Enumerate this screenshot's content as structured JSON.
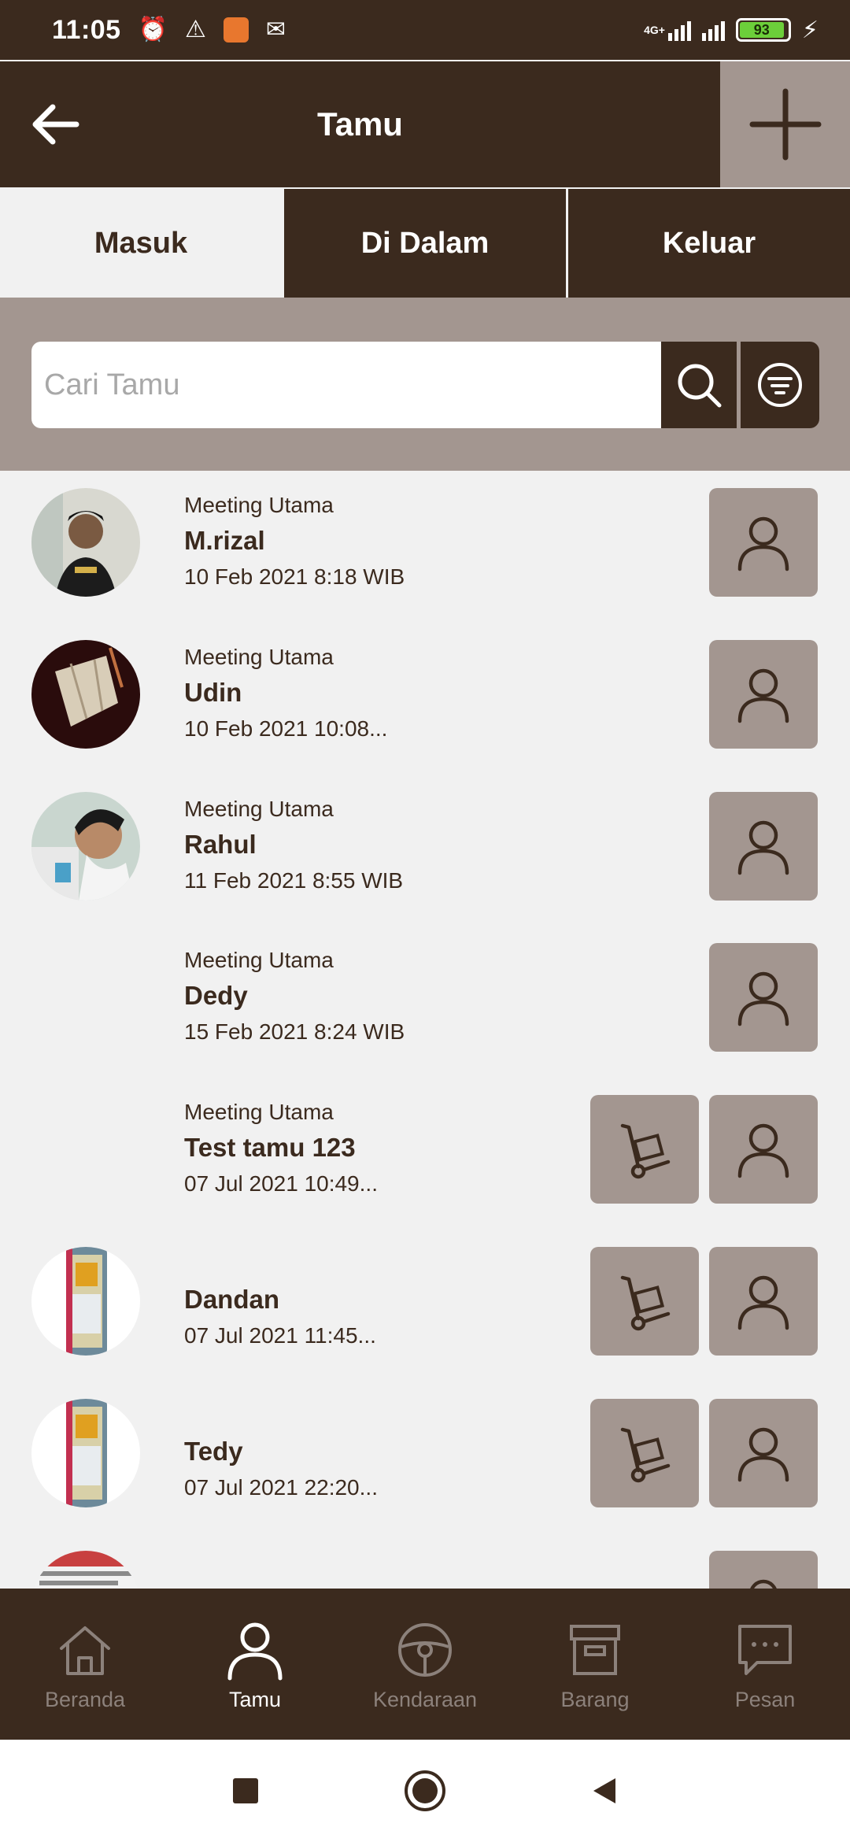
{
  "status_bar": {
    "time": "11:05",
    "network": "4G+",
    "battery": "93",
    "icons": [
      "alarm-icon",
      "warning-icon",
      "app-notification-icon",
      "gmail-icon",
      "signal-icon",
      "battery-icon",
      "charging-icon"
    ]
  },
  "app_bar": {
    "title": "Tamu",
    "back_icon": "arrow-left-icon",
    "add_icon": "plus-icon"
  },
  "tabs": [
    {
      "label": "Masuk",
      "active": true
    },
    {
      "label": "Di Dalam",
      "active": false
    },
    {
      "label": "Keluar",
      "active": false
    }
  ],
  "search": {
    "placeholder": "Cari Tamu",
    "value": "",
    "search_icon": "search-icon",
    "filter_icon": "filter-icon"
  },
  "guests": [
    {
      "room": "Meeting Utama",
      "name": "M.rizal",
      "time": "10 Feb 2021 8:18 WIB",
      "has_photo": true,
      "has_items": false
    },
    {
      "room": "Meeting Utama",
      "name": "Udin",
      "time": "10 Feb 2021 10:08...",
      "has_photo": true,
      "has_items": false
    },
    {
      "room": "Meeting Utama",
      "name": "Rahul",
      "time": "11 Feb 2021 8:55 WIB",
      "has_photo": true,
      "has_items": false
    },
    {
      "room": "Meeting Utama",
      "name": "Dedy",
      "time": "15 Feb 2021 8:24 WIB",
      "has_photo": false,
      "has_items": false
    },
    {
      "room": "Meeting Utama",
      "name": "Test tamu 123",
      "time": "07 Jul 2021 10:49...",
      "has_photo": false,
      "has_items": true
    },
    {
      "room": "",
      "name": "Dandan",
      "time": "07 Jul 2021 11:45...",
      "has_photo": true,
      "has_items": true
    },
    {
      "room": "",
      "name": "Tedy",
      "time": "07 Jul 2021 22:20...",
      "has_photo": true,
      "has_items": true
    }
  ],
  "bottom_nav": [
    {
      "label": "Beranda",
      "icon": "home-icon",
      "active": false
    },
    {
      "label": "Tamu",
      "icon": "person-icon",
      "active": true
    },
    {
      "label": "Kendaraan",
      "icon": "steering-wheel-icon",
      "active": false
    },
    {
      "label": "Barang",
      "icon": "archive-box-icon",
      "active": false
    },
    {
      "label": "Pesan",
      "icon": "chat-icon",
      "active": false
    }
  ],
  "colors": {
    "primary": "#3b2a1e",
    "secondary": "#a39690",
    "background": "#f1f1f1",
    "inactive_nav": "#8c817b"
  }
}
